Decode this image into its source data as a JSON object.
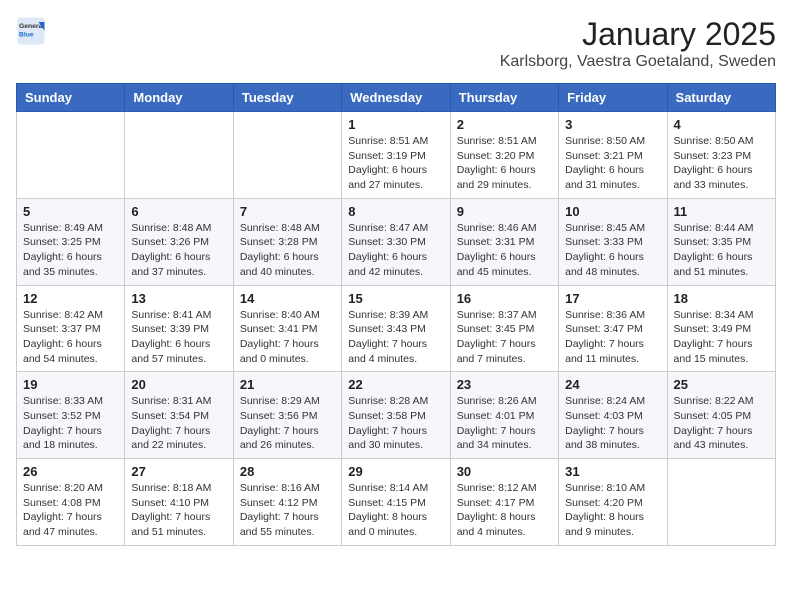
{
  "logo": {
    "general": "General",
    "blue": "Blue"
  },
  "header": {
    "title": "January 2025",
    "subtitle": "Karlsborg, Vaestra Goetaland, Sweden"
  },
  "weekdays": [
    "Sunday",
    "Monday",
    "Tuesday",
    "Wednesday",
    "Thursday",
    "Friday",
    "Saturday"
  ],
  "weeks": [
    [
      {
        "day": "",
        "info": ""
      },
      {
        "day": "",
        "info": ""
      },
      {
        "day": "",
        "info": ""
      },
      {
        "day": "1",
        "info": "Sunrise: 8:51 AM\nSunset: 3:19 PM\nDaylight: 6 hours and 27 minutes."
      },
      {
        "day": "2",
        "info": "Sunrise: 8:51 AM\nSunset: 3:20 PM\nDaylight: 6 hours and 29 minutes."
      },
      {
        "day": "3",
        "info": "Sunrise: 8:50 AM\nSunset: 3:21 PM\nDaylight: 6 hours and 31 minutes."
      },
      {
        "day": "4",
        "info": "Sunrise: 8:50 AM\nSunset: 3:23 PM\nDaylight: 6 hours and 33 minutes."
      }
    ],
    [
      {
        "day": "5",
        "info": "Sunrise: 8:49 AM\nSunset: 3:25 PM\nDaylight: 6 hours and 35 minutes."
      },
      {
        "day": "6",
        "info": "Sunrise: 8:48 AM\nSunset: 3:26 PM\nDaylight: 6 hours and 37 minutes."
      },
      {
        "day": "7",
        "info": "Sunrise: 8:48 AM\nSunset: 3:28 PM\nDaylight: 6 hours and 40 minutes."
      },
      {
        "day": "8",
        "info": "Sunrise: 8:47 AM\nSunset: 3:30 PM\nDaylight: 6 hours and 42 minutes."
      },
      {
        "day": "9",
        "info": "Sunrise: 8:46 AM\nSunset: 3:31 PM\nDaylight: 6 hours and 45 minutes."
      },
      {
        "day": "10",
        "info": "Sunrise: 8:45 AM\nSunset: 3:33 PM\nDaylight: 6 hours and 48 minutes."
      },
      {
        "day": "11",
        "info": "Sunrise: 8:44 AM\nSunset: 3:35 PM\nDaylight: 6 hours and 51 minutes."
      }
    ],
    [
      {
        "day": "12",
        "info": "Sunrise: 8:42 AM\nSunset: 3:37 PM\nDaylight: 6 hours and 54 minutes."
      },
      {
        "day": "13",
        "info": "Sunrise: 8:41 AM\nSunset: 3:39 PM\nDaylight: 6 hours and 57 minutes."
      },
      {
        "day": "14",
        "info": "Sunrise: 8:40 AM\nSunset: 3:41 PM\nDaylight: 7 hours and 0 minutes."
      },
      {
        "day": "15",
        "info": "Sunrise: 8:39 AM\nSunset: 3:43 PM\nDaylight: 7 hours and 4 minutes."
      },
      {
        "day": "16",
        "info": "Sunrise: 8:37 AM\nSunset: 3:45 PM\nDaylight: 7 hours and 7 minutes."
      },
      {
        "day": "17",
        "info": "Sunrise: 8:36 AM\nSunset: 3:47 PM\nDaylight: 7 hours and 11 minutes."
      },
      {
        "day": "18",
        "info": "Sunrise: 8:34 AM\nSunset: 3:49 PM\nDaylight: 7 hours and 15 minutes."
      }
    ],
    [
      {
        "day": "19",
        "info": "Sunrise: 8:33 AM\nSunset: 3:52 PM\nDaylight: 7 hours and 18 minutes."
      },
      {
        "day": "20",
        "info": "Sunrise: 8:31 AM\nSunset: 3:54 PM\nDaylight: 7 hours and 22 minutes."
      },
      {
        "day": "21",
        "info": "Sunrise: 8:29 AM\nSunset: 3:56 PM\nDaylight: 7 hours and 26 minutes."
      },
      {
        "day": "22",
        "info": "Sunrise: 8:28 AM\nSunset: 3:58 PM\nDaylight: 7 hours and 30 minutes."
      },
      {
        "day": "23",
        "info": "Sunrise: 8:26 AM\nSunset: 4:01 PM\nDaylight: 7 hours and 34 minutes."
      },
      {
        "day": "24",
        "info": "Sunrise: 8:24 AM\nSunset: 4:03 PM\nDaylight: 7 hours and 38 minutes."
      },
      {
        "day": "25",
        "info": "Sunrise: 8:22 AM\nSunset: 4:05 PM\nDaylight: 7 hours and 43 minutes."
      }
    ],
    [
      {
        "day": "26",
        "info": "Sunrise: 8:20 AM\nSunset: 4:08 PM\nDaylight: 7 hours and 47 minutes."
      },
      {
        "day": "27",
        "info": "Sunrise: 8:18 AM\nSunset: 4:10 PM\nDaylight: 7 hours and 51 minutes."
      },
      {
        "day": "28",
        "info": "Sunrise: 8:16 AM\nSunset: 4:12 PM\nDaylight: 7 hours and 55 minutes."
      },
      {
        "day": "29",
        "info": "Sunrise: 8:14 AM\nSunset: 4:15 PM\nDaylight: 8 hours and 0 minutes."
      },
      {
        "day": "30",
        "info": "Sunrise: 8:12 AM\nSunset: 4:17 PM\nDaylight: 8 hours and 4 minutes."
      },
      {
        "day": "31",
        "info": "Sunrise: 8:10 AM\nSunset: 4:20 PM\nDaylight: 8 hours and 9 minutes."
      },
      {
        "day": "",
        "info": ""
      }
    ]
  ]
}
